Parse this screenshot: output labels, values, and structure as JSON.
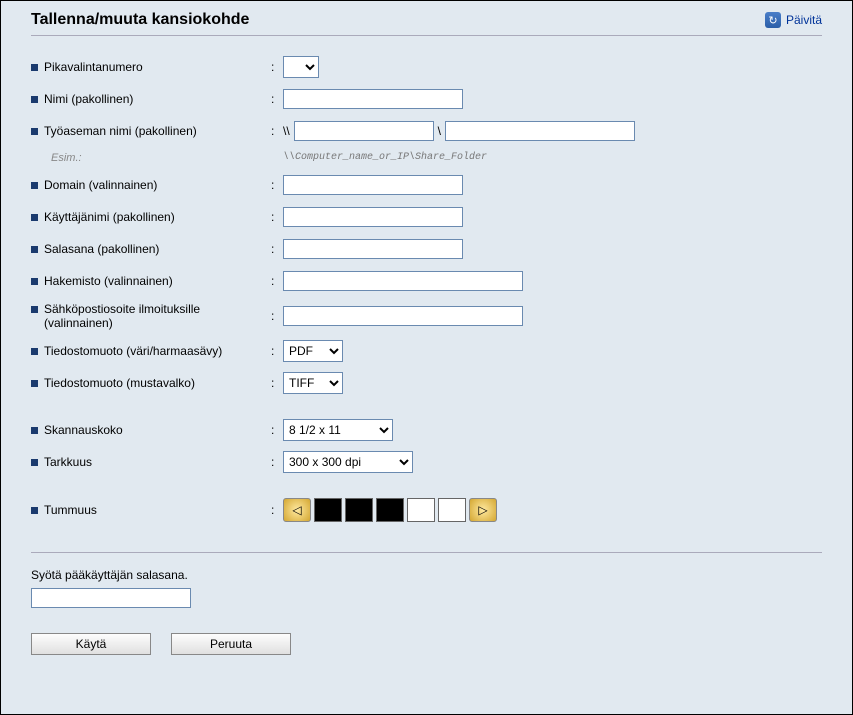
{
  "header": {
    "title": "Tallenna/muuta kansiokohde",
    "refresh": "Päivitä"
  },
  "fields": {
    "speed_dial": {
      "label": "Pikavalintanumero"
    },
    "name": {
      "label": "Nimi (pakollinen)"
    },
    "workstation": {
      "label": "Työaseman nimi (pakollinen)",
      "prefix": "\\\\",
      "sep": "\\"
    },
    "example": {
      "label": "Esim.:",
      "value": "\\\\Computer_name_or_IP\\Share_Folder"
    },
    "domain": {
      "label": "Domain (valinnainen)"
    },
    "username": {
      "label": "Käyttäjänimi (pakollinen)"
    },
    "password": {
      "label": "Salasana (pakollinen)"
    },
    "directory": {
      "label": "Hakemisto (valinnainen)"
    },
    "email": {
      "label": "Sähköpostiosoite ilmoituksille (valinnainen)"
    },
    "format_color": {
      "label": "Tiedostomuoto (väri/harmaasävy)",
      "value": "PDF"
    },
    "format_bw": {
      "label": "Tiedostomuoto (mustavalko)",
      "value": "TIFF"
    },
    "scan_size": {
      "label": "Skannauskoko",
      "value": "8 1/2 x 11"
    },
    "resolution": {
      "label": "Tarkkuus",
      "value": "300 x 300 dpi"
    },
    "darkness": {
      "label": "Tummuus"
    }
  },
  "admin": {
    "label": "Syötä pääkäyttäjän salasana."
  },
  "buttons": {
    "apply": "Käytä",
    "cancel": "Peruuta"
  }
}
